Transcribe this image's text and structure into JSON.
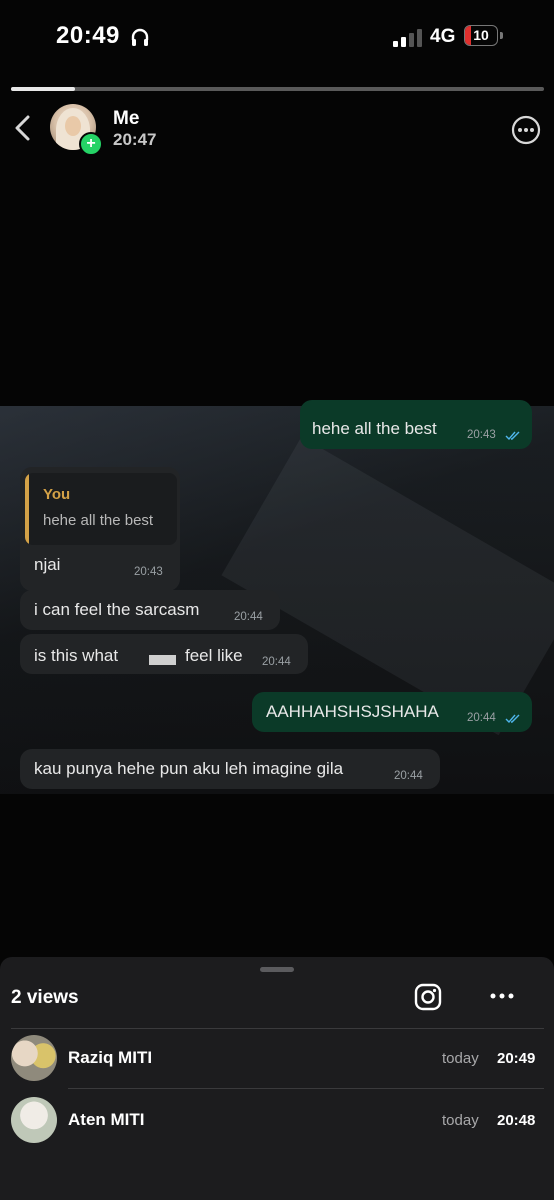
{
  "status_bar": {
    "time": "20:49",
    "network": "4G",
    "battery": "10",
    "battery_color": "#e0302e",
    "headphones_icon": "headphones-icon",
    "signal_icon": "signal-bars-icon"
  },
  "story": {
    "progress": 0.12,
    "user": "Me",
    "posted_time": "20:47",
    "icons": {
      "back": "chevron-left-icon",
      "more": "ellipsis-circle-icon",
      "add": "plus-badge-icon"
    }
  },
  "chat": {
    "out_bubble_color": "#0b3a28",
    "in_bubble_color": "#222426",
    "messages": [
      {
        "text": "hehe all the best",
        "time": "20:43",
        "direction": "out",
        "read": true
      },
      {
        "reply_author": "You",
        "reply_text": "hehe all the best",
        "text": "njai",
        "time": "20:43",
        "direction": "in"
      },
      {
        "text": "i can feel the sarcasm",
        "time": "20:44",
        "direction": "in"
      },
      {
        "text": "is this what",
        "text_after_redaction": "feel like",
        "time": "20:44",
        "direction": "in"
      },
      {
        "text": "AAHHAHSHSJSHAHA",
        "time": "20:44",
        "direction": "out",
        "read": true
      },
      {
        "text": "kau punya hehe pun aku leh imagine gila",
        "time": "20:44",
        "direction": "in"
      }
    ]
  },
  "viewers_sheet": {
    "title": "2 views",
    "icons": {
      "instagram": "instagram-icon",
      "more": "ellipsis-icon"
    },
    "viewers": [
      {
        "name": "Raziq MITI",
        "day": "today",
        "time": "20:49"
      },
      {
        "name": "Aten MITI",
        "day": "today",
        "time": "20:48"
      }
    ]
  }
}
